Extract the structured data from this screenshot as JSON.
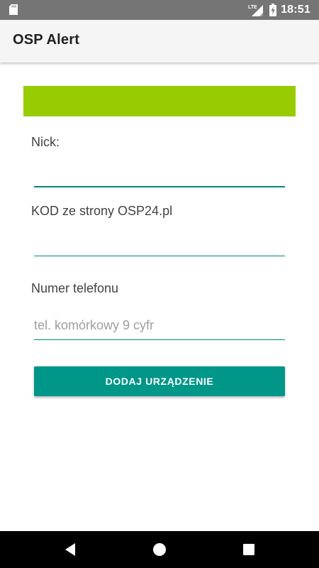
{
  "status_bar": {
    "time": "18:51",
    "network_label": "LTE",
    "icons": [
      "sd-card-icon",
      "lte-signal-icon",
      "battery-charging-icon"
    ]
  },
  "app_bar": {
    "title": "OSP Alert"
  },
  "banner": {
    "color": "#99cc00"
  },
  "form": {
    "nick_label": "Nick:",
    "nick_value": "",
    "code_label": "KOD ze strony OSP24.pl",
    "code_value": "",
    "phone_label": "Numer telefonu",
    "phone_value": "",
    "phone_placeholder": "tel. komórkowy 9 cyfr"
  },
  "button": {
    "label": "DODAJ URZĄDZENIE",
    "color": "#009688"
  },
  "nav_bar": {
    "icons": [
      "back-icon",
      "home-icon",
      "recents-icon"
    ]
  }
}
